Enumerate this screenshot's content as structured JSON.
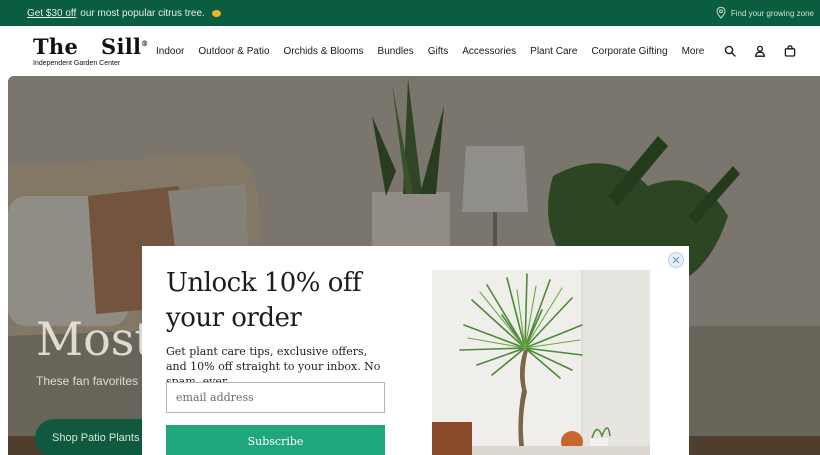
{
  "announcement": {
    "promo_link": "Get $30 off",
    "promo_rest": "our most popular citrus tree.",
    "promo_emoji_icon": "lemon-icon",
    "zone_text": "Find your growing zone"
  },
  "header": {
    "logo_wordmark": "The   Sill",
    "logo_reg": "®",
    "logo_tagline": "Independent Garden Center",
    "nav": [
      "Indoor",
      "Outdoor & Patio",
      "Orchids & Blooms",
      "Bundles",
      "Gifts",
      "Accessories",
      "Plant Care",
      "Corporate Gifting",
      "More"
    ],
    "icons": [
      "search-icon",
      "account-icon",
      "cart-icon"
    ]
  },
  "hero": {
    "title": "Most",
    "subtitle": "These fan favorites",
    "cta": "Shop Patio Plants"
  },
  "modal": {
    "title": "Unlock 10% off your order",
    "body": "Get plant care tips, exclusive offers, and 10% off straight to your inbox. No spam, ever.",
    "email_placeholder": "email address",
    "email_value": "",
    "subscribe_label": "Subscribe",
    "close_icon": "close-icon"
  },
  "colors": {
    "brand_green": "#0b5d3f",
    "subscribe_green": "#20a67d",
    "lemon": "#f3b61c"
  }
}
